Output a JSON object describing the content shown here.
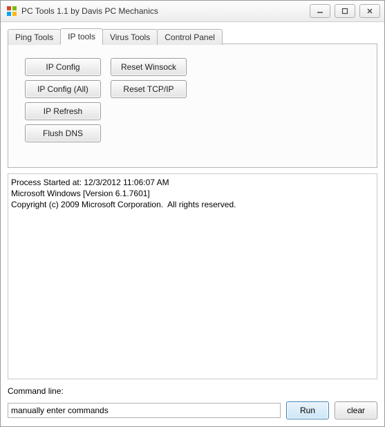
{
  "window": {
    "title": "PC Tools 1.1 by Davis PC Mechanics"
  },
  "tabs": [
    {
      "label": "Ping Tools",
      "selected": false
    },
    {
      "label": "IP tools",
      "selected": true
    },
    {
      "label": "Virus Tools",
      "selected": false
    },
    {
      "label": "Control Panel",
      "selected": false
    }
  ],
  "ip_tools_buttons": {
    "col1": [
      "IP Config",
      "IP Config (All)",
      "IP Refresh",
      "Flush DNS"
    ],
    "col2": [
      "Reset Winsock",
      "Reset TCP/IP"
    ]
  },
  "output_text": "Process Started at: 12/3/2012 11:06:07 AM\nMicrosoft Windows [Version 6.1.7601]\nCopyright (c) 2009 Microsoft Corporation.  All rights reserved.\n",
  "command_line": {
    "label": "Command line:",
    "value": "manually enter commands",
    "run_label": "Run",
    "clear_label": "clear"
  }
}
